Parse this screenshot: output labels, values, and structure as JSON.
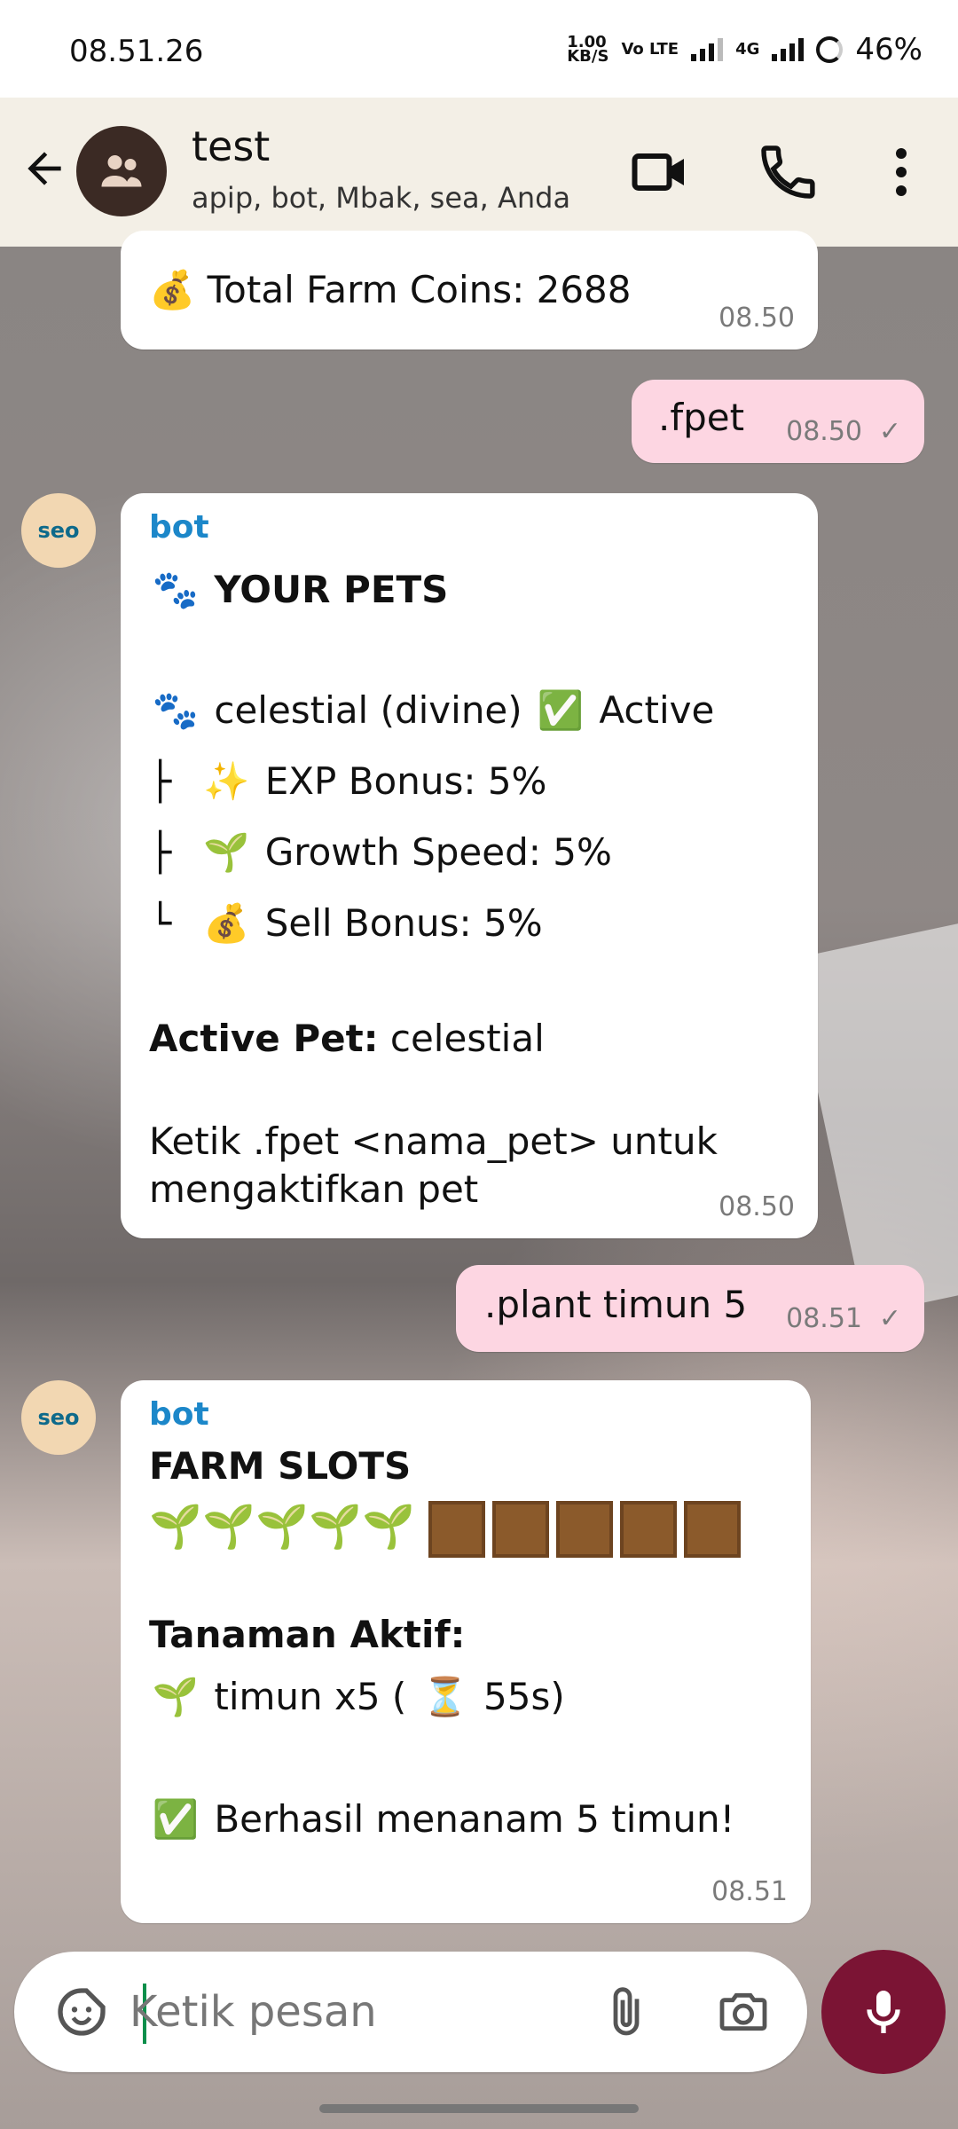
{
  "status": {
    "time": "08.51.26",
    "network_speed_value": "1.00",
    "network_speed_unit": "KB/S",
    "volte": "Vo LTE",
    "mobile_type": "4G",
    "battery": "46%"
  },
  "header": {
    "title": "test",
    "subtitle": "apip, bot, Mbak, sea, Anda"
  },
  "messages": {
    "m1": {
      "text": "💰 Total Farm Coins: 2688",
      "time": "08.50"
    },
    "m2": {
      "text": ".fpet",
      "time": "08.50",
      "status": "✓"
    },
    "m3": {
      "sender": "bot",
      "title": "YOUR PETS",
      "pet_line_name": "celestial (divine)",
      "pet_line_status": "Active",
      "bonus_exp": "EXP Bonus: 5%",
      "bonus_growth": "Growth Speed: 5%",
      "bonus_sell": "Sell Bonus: 5%",
      "active_pet_label": "Active Pet:",
      "active_pet_value": "celestial",
      "instruction_1": "Ketik .fpet <nama_pet> untuk",
      "instruction_2": "mengaktifkan pet",
      "time": "08.50"
    },
    "m4": {
      "text": ".plant timun 5",
      "time": "08.51",
      "status": "✓"
    },
    "m5": {
      "sender": "bot",
      "title": "FARM SLOTS",
      "slots_planted": 5,
      "slots_empty": 5,
      "active_plants_label": "Tanaman Aktif:",
      "plant_line": "timun x5 (",
      "plant_time": "55s)",
      "success": "Berhasil menanam 5 timun!",
      "time": "08.51"
    }
  },
  "composer": {
    "placeholder": "Ketik pesan"
  },
  "colors": {
    "outgoing_bubble": "#fdd6e2",
    "incoming_bubble": "#ffffff",
    "sender": "#1c87c9",
    "mic": "#7b1434",
    "header_bg": "#f3efe6"
  },
  "icons": {
    "back": "back-arrow-icon",
    "group": "group-icon",
    "video": "video-call-icon",
    "call": "phone-call-icon",
    "menu": "more-vertical-icon",
    "emoji": "sticker-icon",
    "attach": "paperclip-icon",
    "camera": "camera-icon",
    "mic": "microphone-icon"
  }
}
